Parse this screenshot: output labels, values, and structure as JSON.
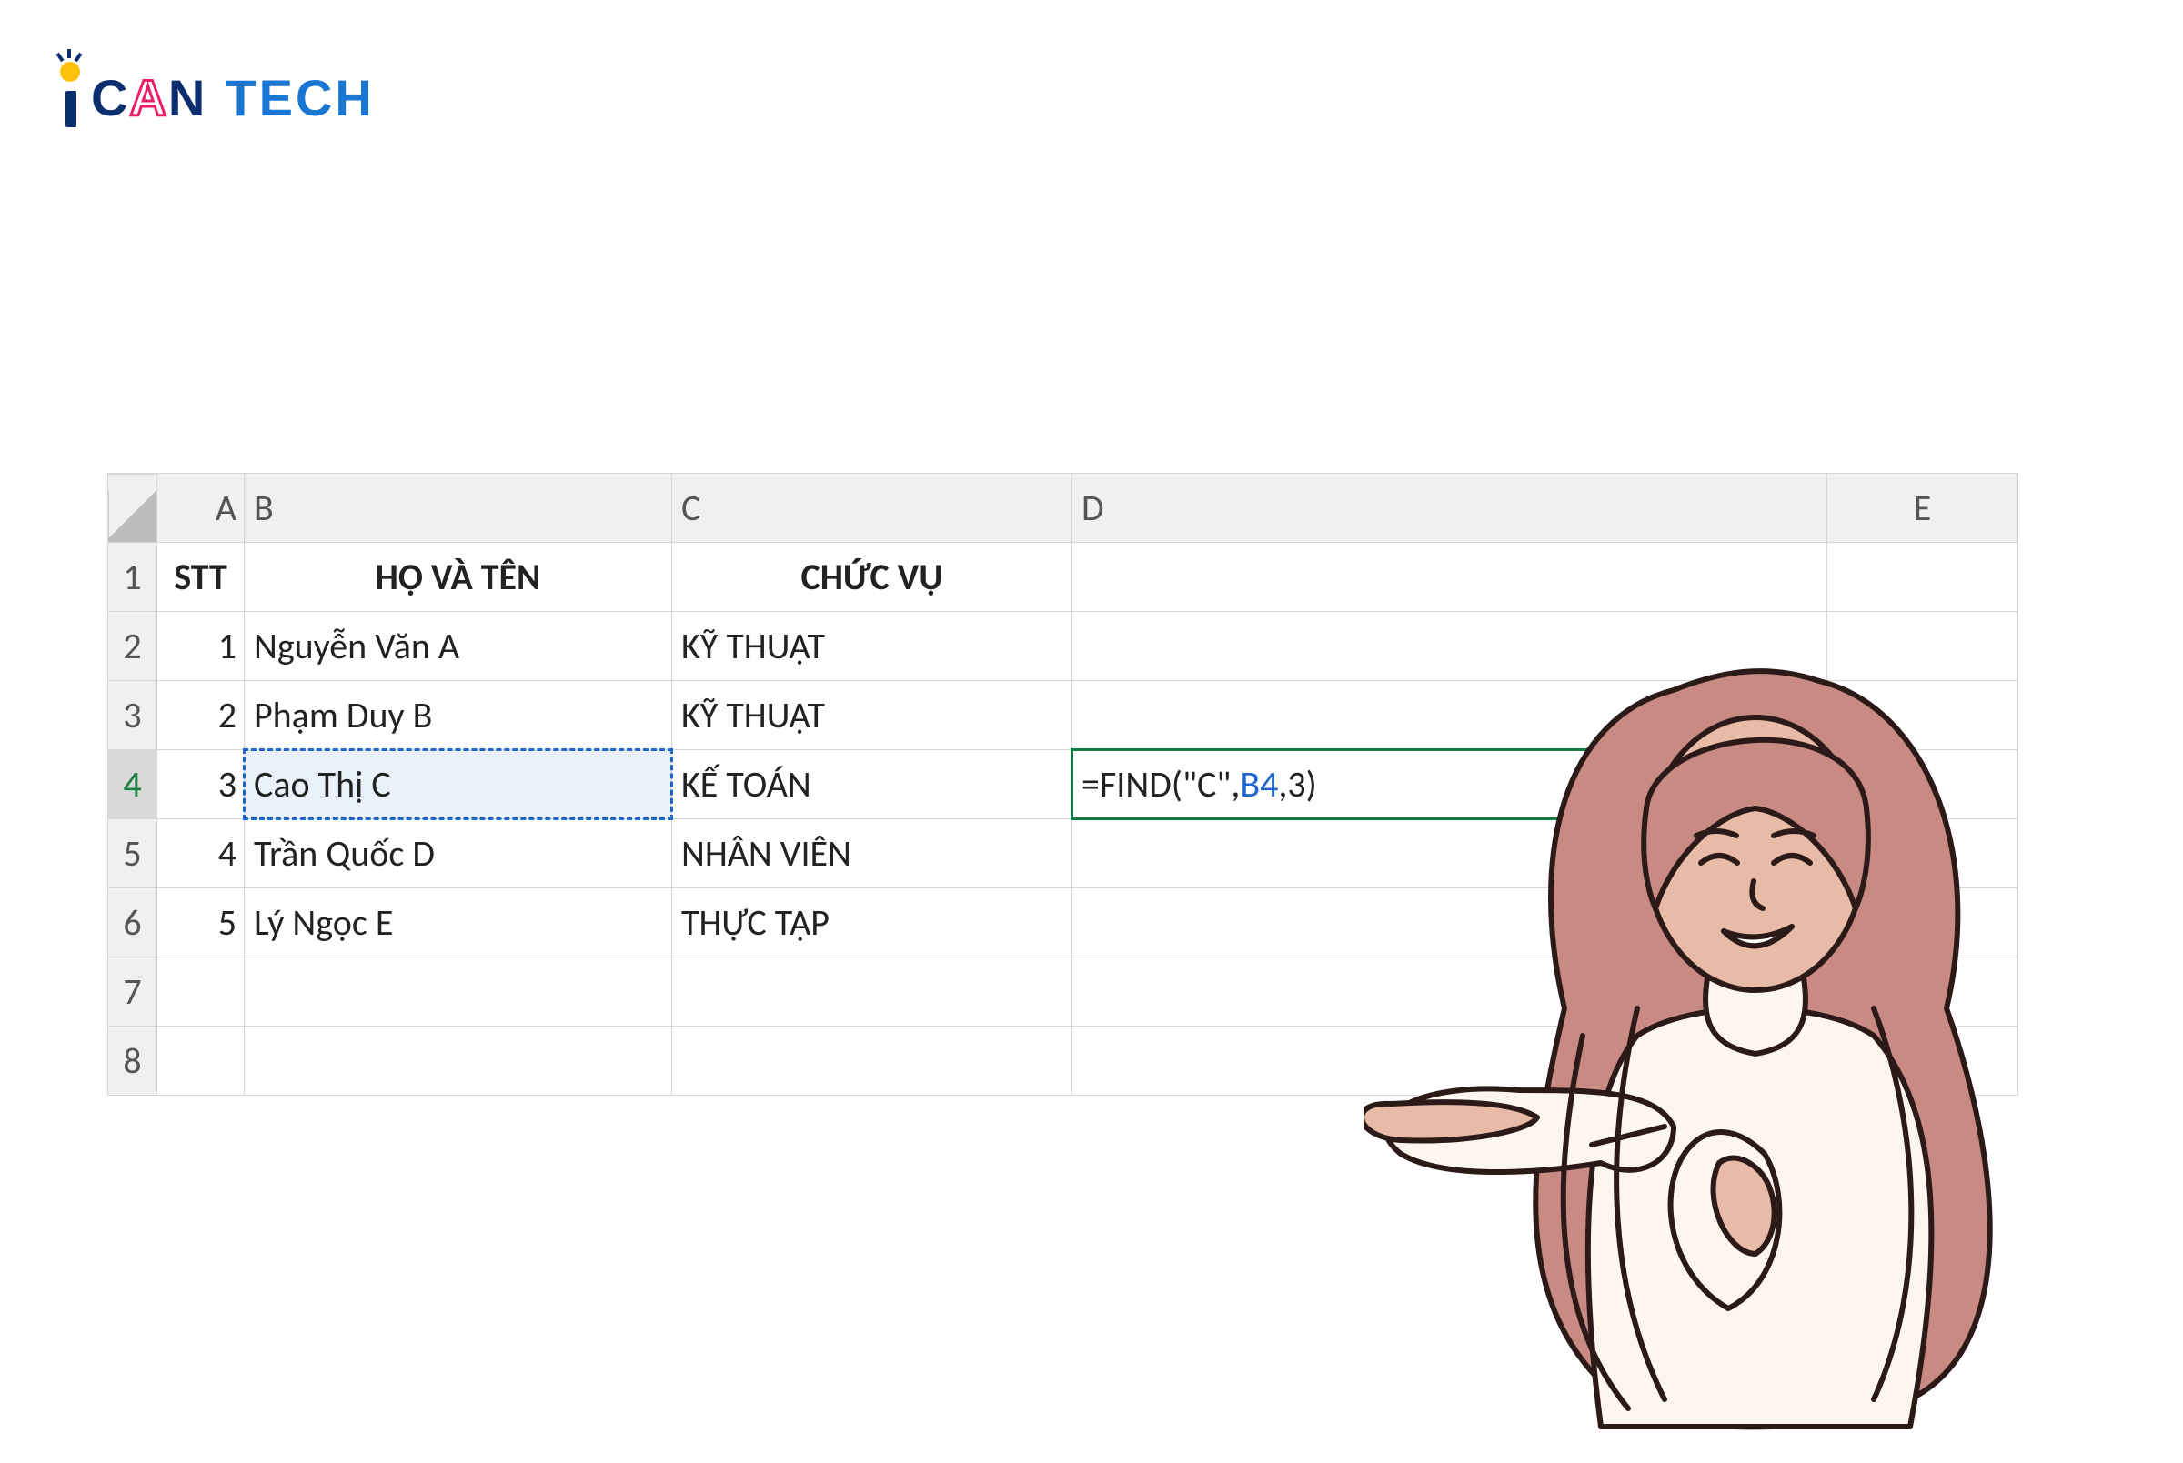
{
  "logo": {
    "text1": "CAN",
    "text2": "TECH"
  },
  "columns": [
    "A",
    "B",
    "C",
    "D",
    "E"
  ],
  "rows": [
    "1",
    "2",
    "3",
    "4",
    "5",
    "6",
    "7",
    "8"
  ],
  "header": {
    "a": "STT",
    "b": "HỌ VÀ TÊN",
    "c": "CHỨC VỤ"
  },
  "data": [
    {
      "stt": "1",
      "name": "Nguyễn Văn A",
      "role": "KỸ THUẬT"
    },
    {
      "stt": "2",
      "name": "Phạm Duy B",
      "role": "KỸ THUẬT"
    },
    {
      "stt": "3",
      "name": "Cao Thị C",
      "role": "KẾ TOÁN"
    },
    {
      "stt": "4",
      "name": "Trần Quốc D",
      "role": "NHÂN VIÊN"
    },
    {
      "stt": "5",
      "name": "Lý Ngọc E",
      "role": "THỰC TẬP"
    }
  ],
  "formula": {
    "pre": "=FIND(\"C\",",
    "ref": "B4",
    "post": ",3)"
  },
  "active_cell": "D4",
  "referenced_cell": "B4"
}
